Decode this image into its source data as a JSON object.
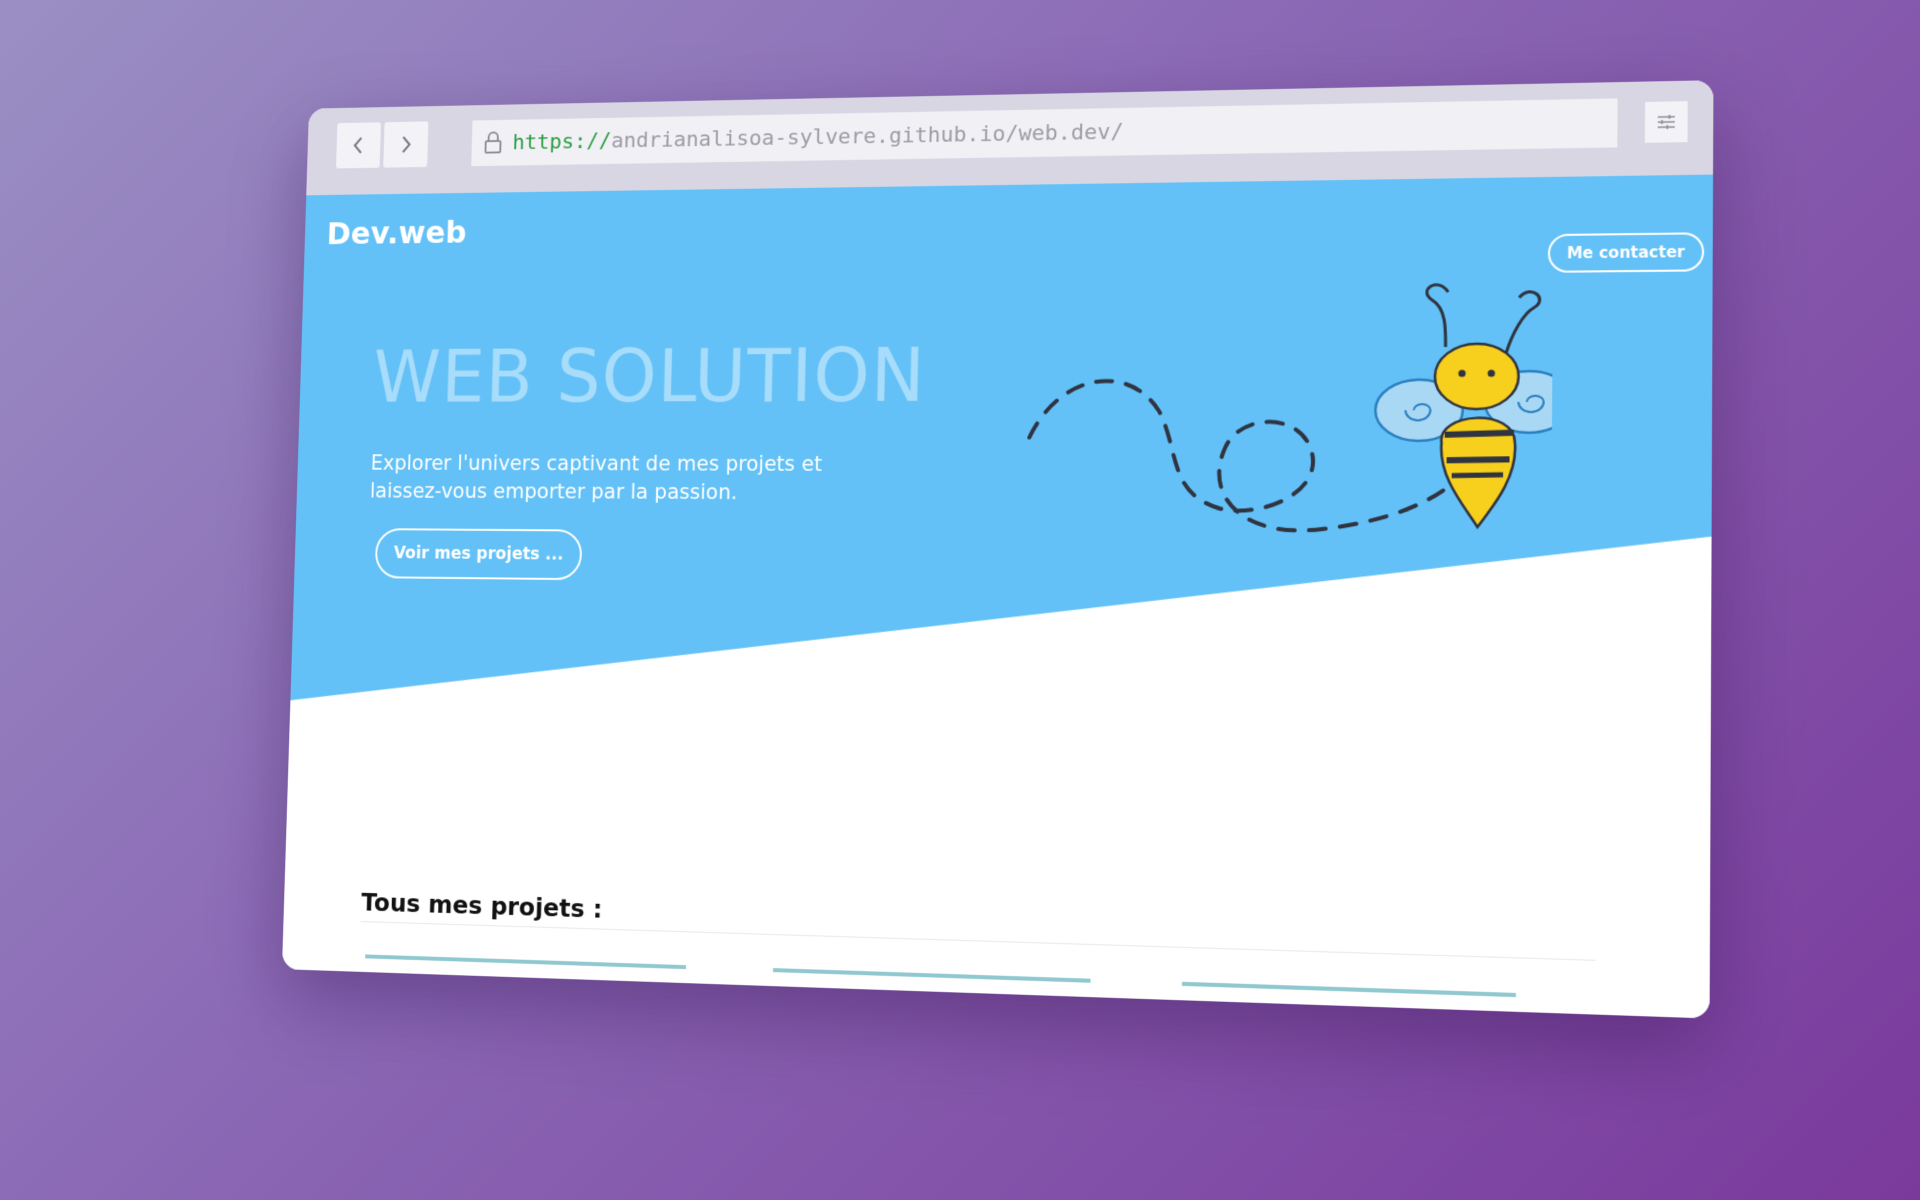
{
  "browser": {
    "url_scheme": "https://",
    "url_rest": "andrianalisoa-sylvere.github.io/web.dev/",
    "icons": {
      "back": "chevron-left-icon",
      "forward": "chevron-right-icon",
      "lock": "lock-icon",
      "menu": "sliders-icon"
    }
  },
  "site": {
    "brand": "Dev.web",
    "contact_button": "Me contacter",
    "hero": {
      "title": "WEB SOLUTION",
      "text": "Explorer l'univers captivant de mes projets et laissez-vous emporter par la passion.",
      "cta_button": "Voir mes projets ..."
    },
    "projects_section": {
      "title": "Tous mes projets :"
    }
  },
  "colors": {
    "hero_background": "#63c1f7",
    "hero_title": "#a8dcfb",
    "url_scheme": "#2e9e44",
    "card_accent": "#8fc9cf"
  }
}
